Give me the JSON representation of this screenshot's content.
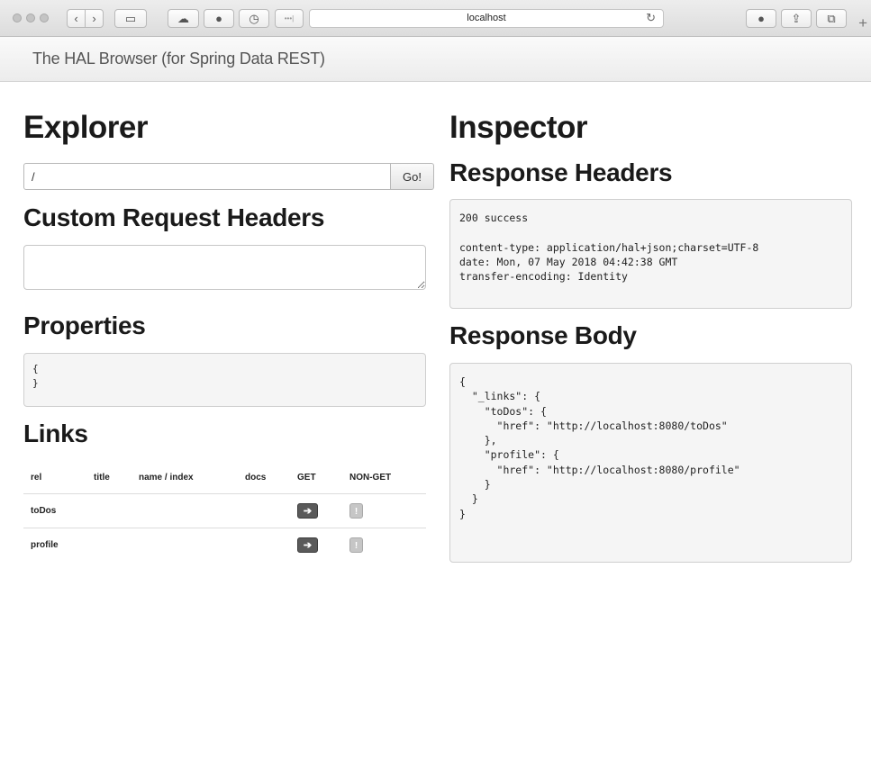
{
  "browser": {
    "url": "localhost",
    "reload_icon": "↻",
    "new_tab_icon": "+",
    "buttons": {
      "back": "‹",
      "forward": "›",
      "sidebar": "▭",
      "cloud": "☁",
      "circle": "●",
      "history": "◷",
      "dots": "•••|",
      "download": "●",
      "share": "⇪",
      "tabs": "⧉"
    }
  },
  "navbar": {
    "brand": "The HAL Browser (for Spring Data REST)"
  },
  "explorer": {
    "title": "Explorer",
    "url_value": "/",
    "go_label": "Go!",
    "custom_headers_title": "Custom Request Headers",
    "custom_headers_value": "",
    "properties_title": "Properties",
    "properties_body": "{\n}",
    "links_title": "Links",
    "links_columns": [
      "rel",
      "title",
      "name / index",
      "docs",
      "GET",
      "NON-GET"
    ],
    "links_rows": [
      {
        "rel": "toDos",
        "title": "",
        "name": "",
        "docs": "",
        "get_icon": "➔",
        "nonget_icon": "!"
      },
      {
        "rel": "profile",
        "title": "",
        "name": "",
        "docs": "",
        "get_icon": "➔",
        "nonget_icon": "!"
      }
    ]
  },
  "inspector": {
    "title": "Inspector",
    "response_headers_title": "Response Headers",
    "response_headers_body": "200 success\n\ncontent-type: application/hal+json;charset=UTF-8\ndate: Mon, 07 May 2018 04:42:38 GMT\ntransfer-encoding: Identity",
    "response_body_title": "Response Body",
    "response_body": "{\n  \"_links\": {\n    \"toDos\": {\n      \"href\": \"http://localhost:8080/toDos\"\n    },\n    \"profile\": {\n      \"href\": \"http://localhost:8080/profile\"\n    }\n  }\n}"
  }
}
